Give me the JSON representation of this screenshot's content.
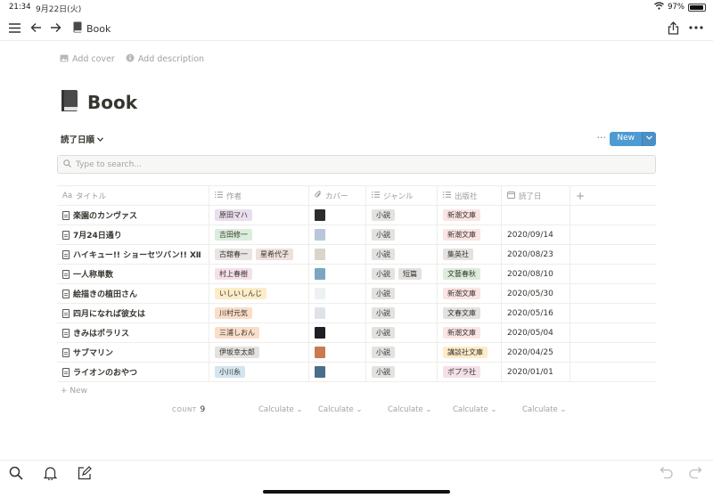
{
  "status": {
    "time": "21:34",
    "date": "9月22日(火)",
    "battery": "97%",
    "battery_level": 0.97
  },
  "topbar": {
    "title": "Book",
    "menu_icon": "hamburger-icon",
    "back_icon": "arrow-left-icon",
    "forward_icon": "arrow-right-icon",
    "share_icon": "share-icon",
    "more_icon": "more-horizontal-icon"
  },
  "page": {
    "add_cover": "Add cover",
    "add_description": "Add description",
    "title": "Book",
    "view_name": "読了日順",
    "new_label": "New",
    "search_placeholder": "Type to search...",
    "add_new_row": "+ New"
  },
  "table": {
    "columns": [
      "タイトル",
      "作者",
      "カバー",
      "ジャンル",
      "出版社",
      "読了日"
    ],
    "rows": [
      {
        "title": "楽園のカンヴァス",
        "author": "原田マハ",
        "author_color": "#e8deee",
        "cover_color": "#2c2c2c",
        "genres": [
          "小説"
        ],
        "publisher": "新潮文庫",
        "publisher_color": "#fbe4e4",
        "date": ""
      },
      {
        "title": "7月24日通り",
        "author": "吉田修一",
        "author_color": "#dbeddb",
        "cover_color": "#b8c7d9",
        "genres": [
          "小説"
        ],
        "publisher": "新潮文庫",
        "publisher_color": "#fbe4e4",
        "date": "2020/09/14"
      },
      {
        "title": "ハイキュー!! ショーセツバン!! Ⅻ",
        "author": "古舘春一",
        "author2": "星希代子",
        "author_color": "#e9e5e3",
        "author2_color": "#eee0da",
        "cover_color": "#d9d4cc",
        "genres": [
          "小説"
        ],
        "publisher": "集英社",
        "publisher_color": "#e3e2e0",
        "date": "2020/08/23"
      },
      {
        "title": "一人称単数",
        "author": "村上春樹",
        "author_color": "#f5e0e9",
        "cover_color": "#7aa6c2",
        "genres": [
          "小説",
          "短篇"
        ],
        "publisher": "文藝春秋",
        "publisher_color": "#dbeddb",
        "date": "2020/08/10"
      },
      {
        "title": "絵描きの植田さん",
        "author": "いしいしんじ",
        "author_color": "#fdecc8",
        "cover_color": "#eef1f4",
        "genres": [
          "小説"
        ],
        "publisher": "新潮文庫",
        "publisher_color": "#fbe4e4",
        "date": "2020/05/30"
      },
      {
        "title": "四月になれば彼女は",
        "author": "川村元気",
        "author_color": "#fadec9",
        "cover_color": "#dfe3e8",
        "genres": [
          "小説"
        ],
        "publisher": "文春文庫",
        "publisher_color": "#e3e2e0",
        "date": "2020/05/16"
      },
      {
        "title": "きみはポラリス",
        "author": "三浦しおん",
        "author_color": "#fadec9",
        "cover_color": "#1e1e24",
        "genres": [
          "小説"
        ],
        "publisher": "新潮文庫",
        "publisher_color": "#fbe4e4",
        "date": "2020/05/04"
      },
      {
        "title": "サブマリン",
        "author": "伊坂幸太郎",
        "author_color": "#e3e2e0",
        "cover_color": "#c97a4e",
        "genres": [
          "小説"
        ],
        "publisher": "講談社文庫",
        "publisher_color": "#fdecc8",
        "date": "2020/04/25"
      },
      {
        "title": "ライオンのおやつ",
        "author": "小川糸",
        "author_color": "#d3e5ef",
        "cover_color": "#4a6e8a",
        "genres": [
          "小説"
        ],
        "publisher": "ポプラ社",
        "publisher_color": "#f5e0e9",
        "date": "2020/01/01"
      }
    ],
    "genre_color": "#e3e2e0"
  },
  "footer": {
    "count_label": "COUNT",
    "count_value": "9",
    "calculate": "Calculate"
  },
  "bottombar": {
    "search_icon": "search-icon",
    "bell_icon": "bell-icon",
    "compose_icon": "compose-icon",
    "undo_icon": "undo-icon",
    "redo_icon": "redo-icon"
  }
}
